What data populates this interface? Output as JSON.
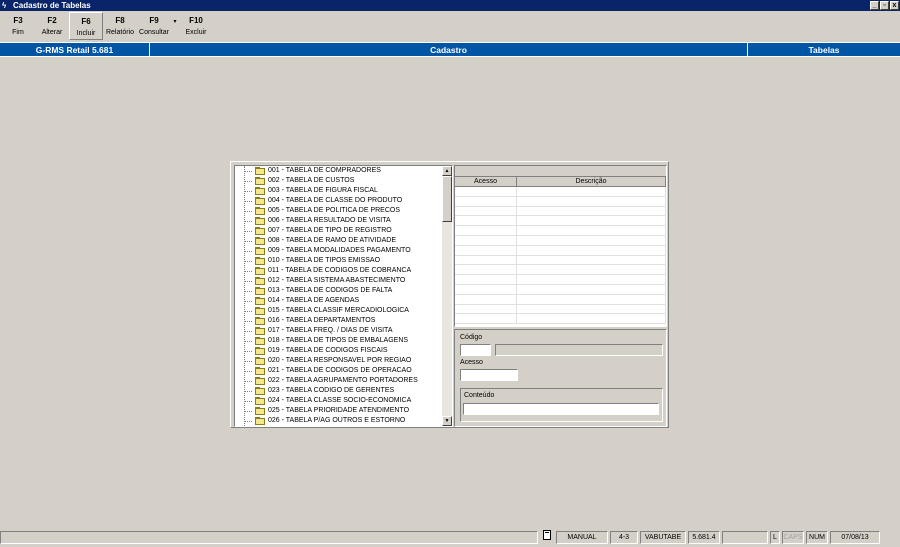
{
  "window": {
    "title": "Cadastro de Tabelas",
    "app_icon": "lightning-icon",
    "controls": [
      "_",
      "▫",
      "x"
    ]
  },
  "toolbar": {
    "buttons": [
      {
        "key": "F3",
        "label": "Fim"
      },
      {
        "key": "F2",
        "label": "Alterar"
      },
      {
        "key": "F6",
        "label": "Incluir"
      },
      {
        "key": "F8",
        "label": "Relatório"
      },
      {
        "key": "F9",
        "label": "Consultar"
      },
      {
        "key": "F10",
        "label": "Excluir"
      }
    ],
    "dropdown_icon": "▾"
  },
  "header": {
    "left": "G-RMS Retail 5.681",
    "center": "Cadastro",
    "right": "Tabelas"
  },
  "tree": {
    "items": [
      "001 - TABELA DE COMPRADORES",
      "002 - TABELA DE CUSTOS",
      "003 - TABELA DE FIGURA FISCAL",
      "004 - TABELA DE CLASSE DO PRODUTO",
      "005 - TABELA DE POLITICA DE PRECOS",
      "006 - TABELA RESULTADO DE VISITA",
      "007 - TABELA DE TIPO DE REGISTRO",
      "008 - TABELA DE RAMO DE ATIVIDADE",
      "009 - TABELA MODALIDADES  PAGAMENTO",
      "010 - TABELA DE TIPOS EMISSAO",
      "011 - TABELA DE CODIGOS DE COBRANCA",
      "012 - TABELA SISTEMA ABASTECIMENTO",
      "013 - TABELA DE CODIGOS DE FALTA",
      "014 - TABELA DE AGENDAS",
      "015 - TABELA CLASSIF MERCADIOLOGICA",
      "016 - TABELA DEPARTAMENTOS",
      "017 - TABELA FREQ. / DIAS DE VISITA",
      "018 - TABELA DE TIPOS DE EMBALAGENS",
      "019 - TABELA DE CODIGOS FISCAIS",
      "020 - TABELA RESPONSAVEL POR REGIAO",
      "021 - TABELA DE CODIGOS DE OPERACAO",
      "022 - TABELA AGRUPAMENTO PORTADORES",
      "023 - TABELA CODIGO DE GERENTES",
      "024 - TABELA CLASSE SOCIO-ECONOMICA",
      "025 - TABELA PRIORIDADE ATENDIMENTO",
      "026 - TABELA P/AG OUTROS E ESTORNO"
    ]
  },
  "grid": {
    "columns": [
      "Acesso",
      "Descrição"
    ]
  },
  "form": {
    "codigo_label": "Código",
    "acesso_label": "Acesso",
    "conteudo_label": "Conteúdo",
    "codigo_value": "",
    "codigo_desc_value": "",
    "acesso_value": "",
    "conteudo_value": ""
  },
  "status": {
    "mode": "MANUAL",
    "page": "4-3",
    "program": "VABUTABE",
    "version": "5.681.4",
    "lock": "L",
    "caps": "CAPS",
    "num": "NUM",
    "date": "07/08/13"
  }
}
